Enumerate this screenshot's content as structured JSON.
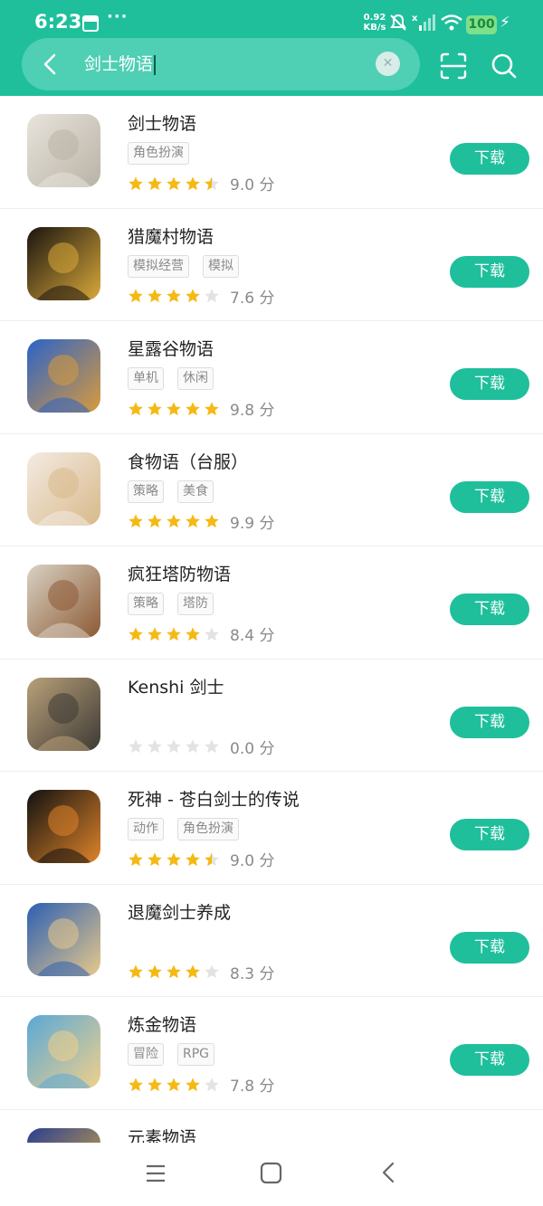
{
  "status": {
    "time": "6:23",
    "more": "···",
    "net_speed": "0.92",
    "net_unit": "KB/s",
    "battery": "100"
  },
  "search": {
    "query": "剑士物语"
  },
  "apps": [
    {
      "name": "剑士物语",
      "tags": [
        "角色扮演"
      ],
      "score": "9.0 分",
      "stars": 4.5,
      "button": "下载",
      "icon": "swordgirl-icon",
      "colors": [
        "#e8e4dc",
        "#b9b2a6"
      ]
    },
    {
      "name": "猎魔村物语",
      "tags": [
        "模拟经营",
        "模拟"
      ],
      "score": "7.6 分",
      "stars": 4,
      "button": "下载",
      "icon": "pixel-knight-icon",
      "colors": [
        "#1a1410",
        "#d9a93a"
      ]
    },
    {
      "name": "星露谷物语",
      "tags": [
        "单机",
        "休闲"
      ],
      "score": "9.8 分",
      "stars": 5,
      "button": "下载",
      "icon": "pixel-chicken-icon",
      "colors": [
        "#2b63c9",
        "#d99a3b"
      ]
    },
    {
      "name": "食物语（台服）",
      "tags": [
        "策略",
        "美食"
      ],
      "score": "9.9 分",
      "stars": 5,
      "button": "下载",
      "icon": "food-girl-icon",
      "colors": [
        "#f3ebe2",
        "#d8b98a"
      ]
    },
    {
      "name": "疯狂塔防物语",
      "tags": [
        "策略",
        "塔防"
      ],
      "score": "8.4 分",
      "stars": 4,
      "button": "下载",
      "icon": "tower-boy-icon",
      "colors": [
        "#d9d2c4",
        "#8c5a34"
      ]
    },
    {
      "name": "Kenshi 剑士",
      "tags": [],
      "score": "0.0 分",
      "stars": 0,
      "button": "下载",
      "icon": "desert-wanderer-icon",
      "colors": [
        "#b9a079",
        "#3d3a35"
      ]
    },
    {
      "name": "死神 - 苍白剑士的传说",
      "tags": [
        "动作",
        "角色扮演"
      ],
      "score": "9.0 分",
      "stars": 4.5,
      "button": "下载",
      "icon": "reaper-mask-icon",
      "colors": [
        "#111111",
        "#e0842a"
      ]
    },
    {
      "name": "退魔剑士养成",
      "tags": [],
      "score": "8.3 分",
      "stars": 4,
      "button": "下载",
      "icon": "demon-swordsman-icon",
      "colors": [
        "#2c5fb3",
        "#e8c98a"
      ]
    },
    {
      "name": "炼金物语",
      "tags": [
        "冒险",
        "RPG"
      ],
      "score": "7.8 分",
      "stars": 4,
      "button": "下载",
      "icon": "alchemy-girl-icon",
      "colors": [
        "#5aa8d8",
        "#f0d08a"
      ]
    },
    {
      "name": "元素物语",
      "tags": [],
      "score": "",
      "stars": 0,
      "button": "",
      "icon": "element-icon",
      "colors": [
        "#2a3f8f",
        "#e0b040"
      ]
    }
  ],
  "theme": {
    "accent": "#1fbf9c",
    "star_on": "#f5b914",
    "star_off": "#e3e3e3"
  }
}
